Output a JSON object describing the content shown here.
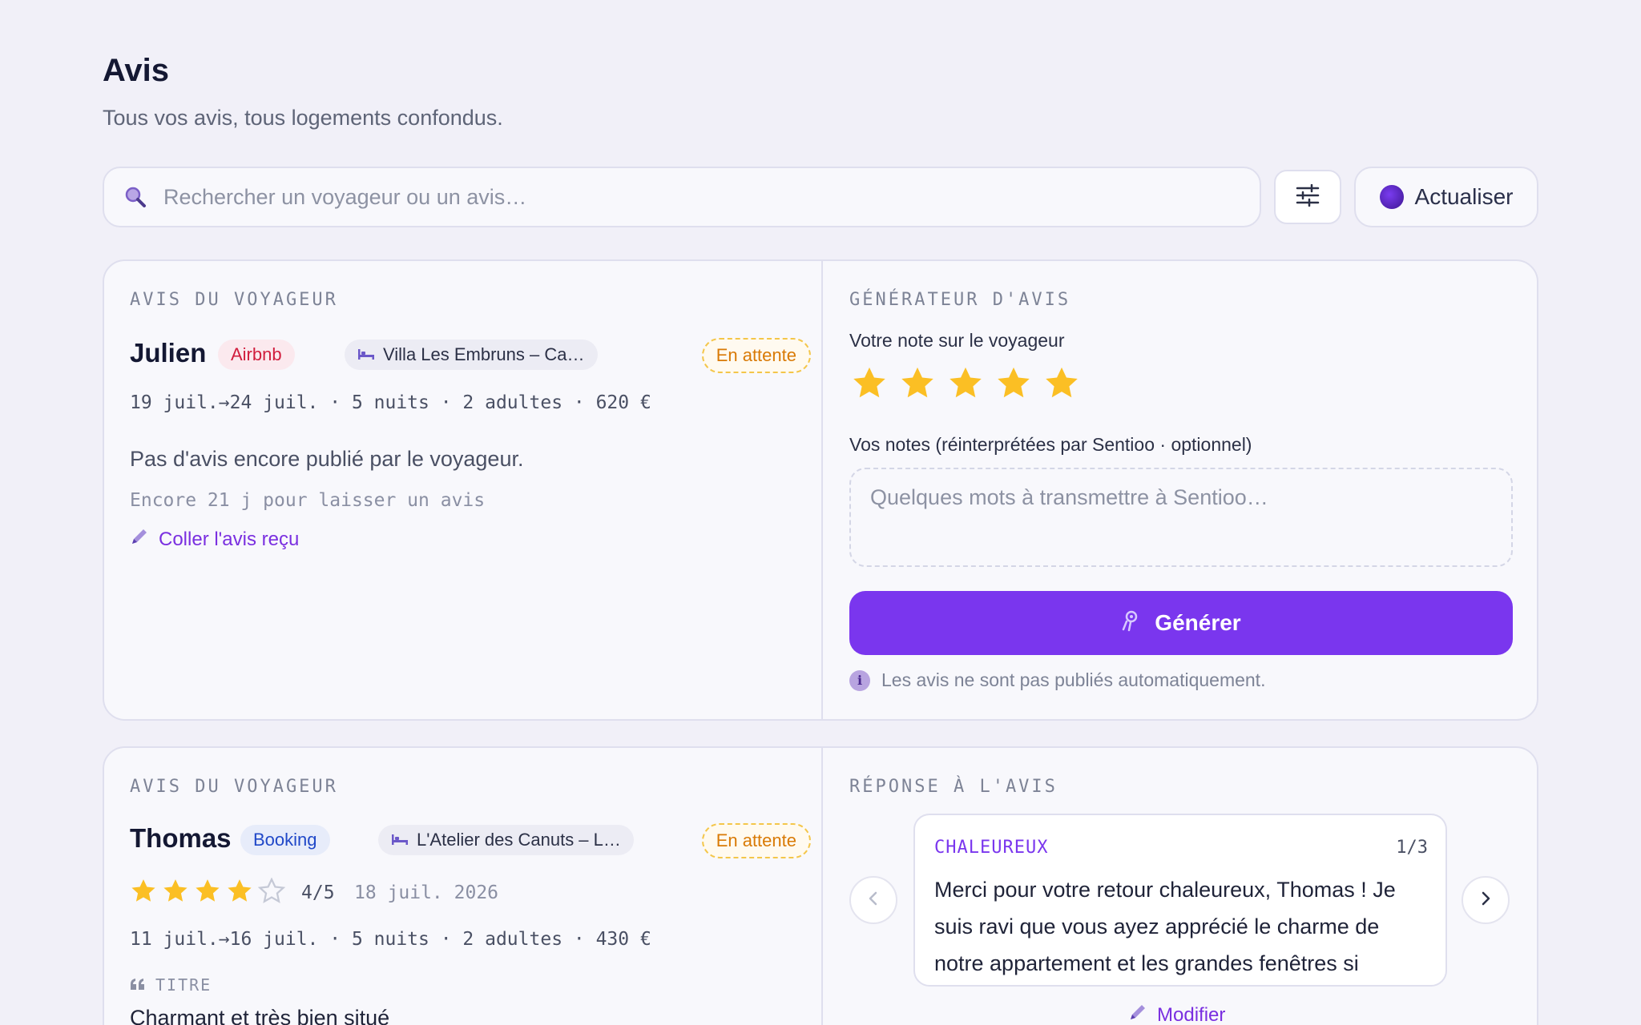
{
  "header": {
    "title": "Avis",
    "subtitle": "Tous vos avis, tous logements confondus."
  },
  "toolbar": {
    "search_placeholder": "Rechercher un voyageur ou un avis…",
    "search_icon": "search-icon",
    "filter_icon": "sliders-icon",
    "refresh_label": "Actualiser"
  },
  "cards": [
    {
      "left_label": "AVIS DU VOYAGEUR",
      "guest": "Julien",
      "platform": "Airbnb",
      "listing": "Villa Les Embruns – Ca…",
      "status": "En attente",
      "stay": "19 juil.→24 juil. · 5 nuits · 2 adultes · 620 €",
      "empty_message": "Pas d'avis encore publié par le voyageur.",
      "countdown": "Encore 21 j pour laisser un avis",
      "paste_link": "Coller l'avis reçu",
      "right_label": "GÉNÉRATEUR D'AVIS",
      "rating_label": "Votre note sur le voyageur",
      "host_rating": 5,
      "notes_label": "Vos notes (réinterprétées par Sentioo · optionnel)",
      "notes_placeholder": "Quelques mots à transmettre à Sentioo…",
      "generate_label": "Générer",
      "info": "Les avis ne sont pas publiés automatiquement."
    },
    {
      "left_label": "AVIS DU VOYAGEUR",
      "guest": "Thomas",
      "platform": "Booking",
      "listing": "L'Atelier des Canuts – L…",
      "status": "En attente",
      "rating": 4,
      "rating_max": 5,
      "rating_text": "4/5",
      "review_date": "18 juil. 2026",
      "stay": "11 juil.→16 juil. · 5 nuits · 2 adultes · 430 €",
      "title_label": "TITRE",
      "review_title": "Charmant et très bien situé",
      "right_label": "RÉPONSE À L'AVIS",
      "reply_tone": "CHALEUREUX",
      "reply_counter": "1/3",
      "reply_text": "Merci pour votre retour chaleureux, Thomas ! Je suis ravi que vous ayez apprécié le charme de notre appartement et les grandes fenêtres si",
      "edit_label": "Modifier"
    }
  ],
  "colors": {
    "accent": "#7a36ee",
    "star": "#fbbf24",
    "pending": "#d97a06",
    "airbnb": "#d11d3d",
    "booking": "#2048c8"
  }
}
